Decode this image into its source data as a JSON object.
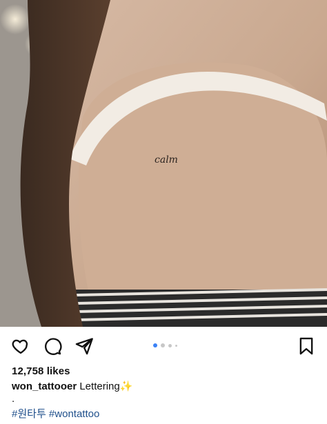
{
  "post": {
    "photo_alt": "calm",
    "tattoo_text": "calm",
    "likes": "12,758 likes",
    "username": "won_tattooer",
    "caption": " Lettering✨",
    "period": ".",
    "hashtags": [
      "#원타투",
      "#wontattoo"
    ]
  },
  "carousel": {
    "current": 1,
    "total": 4,
    "active_color": "#3b82f6"
  },
  "icons": {
    "like": "heart-icon",
    "comment": "comment-icon",
    "share": "paper-plane-icon",
    "save": "bookmark-icon"
  }
}
